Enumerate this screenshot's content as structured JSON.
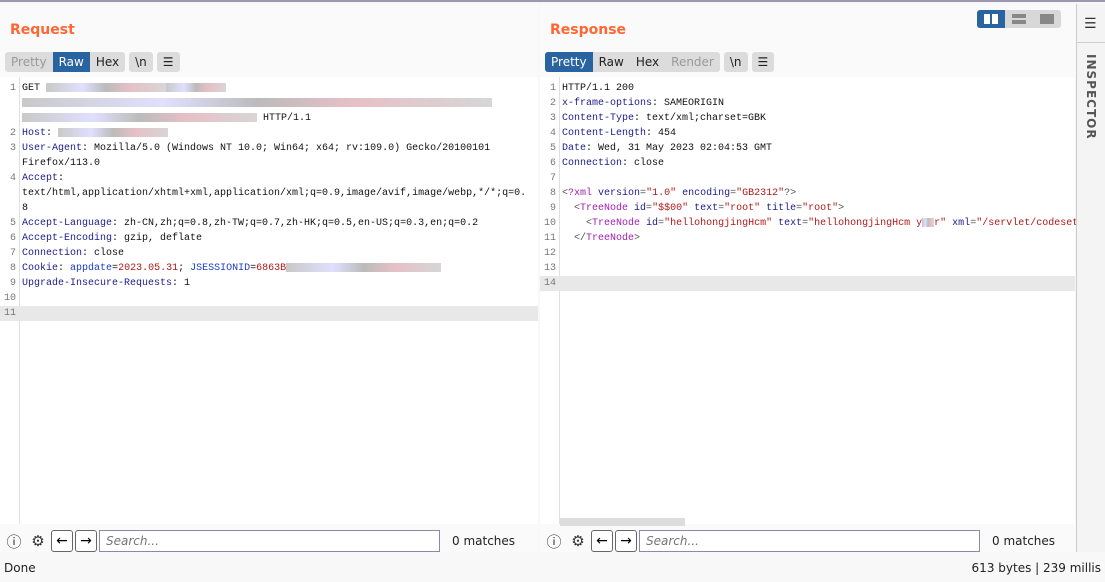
{
  "request": {
    "title": "Request",
    "tabs": [
      {
        "label": "Pretty",
        "state": "disabled"
      },
      {
        "label": "Raw",
        "state": "active"
      },
      {
        "label": "Hex",
        "state": "normal"
      }
    ],
    "newline_label": "\\n",
    "lines": [
      {
        "n": "1",
        "rows": [
          [
            [
              "v",
              "GET "
            ],
            [
              "red",
              120
            ],
            [
              "red",
              60
            ]
          ],
          [
            [
              "red",
              470
            ]
          ],
          [
            [
              "red",
              235
            ],
            [
              "v",
              " HTTP/1.1"
            ]
          ]
        ]
      },
      {
        "n": "2",
        "rows": [
          [
            [
              "k",
              "Host"
            ],
            [
              "v",
              ": "
            ],
            [
              "red",
              110
            ]
          ]
        ]
      },
      {
        "n": "3",
        "rows": [
          [
            [
              "k",
              "User-Agent"
            ],
            [
              "v",
              ": Mozilla/5.0 (Windows NT 10.0; Win64; x64; rv:109.0) Gecko/20100101"
            ]
          ],
          [
            [
              "v",
              "Firefox/113.0"
            ]
          ]
        ]
      },
      {
        "n": "4",
        "rows": [
          [
            [
              "k",
              "Accept"
            ],
            [
              "v",
              ":"
            ]
          ],
          [
            [
              "v",
              "text/html,application/xhtml+xml,application/xml;q=0.9,image/avif,image/webp,*/*;q=0."
            ]
          ],
          [
            [
              "v",
              "8"
            ]
          ]
        ]
      },
      {
        "n": "5",
        "rows": [
          [
            [
              "k",
              "Accept-Language"
            ],
            [
              "v",
              ": zh-CN,zh;q=0.8,zh-TW;q=0.7,zh-HK;q=0.5,en-US;q=0.3,en;q=0.2"
            ]
          ]
        ]
      },
      {
        "n": "6",
        "rows": [
          [
            [
              "k",
              "Accept-Encoding"
            ],
            [
              "v",
              ": gzip, deflate"
            ]
          ]
        ]
      },
      {
        "n": "7",
        "rows": [
          [
            [
              "k",
              "Connection"
            ],
            [
              "v",
              ": close"
            ]
          ]
        ]
      },
      {
        "n": "8",
        "rows": [
          [
            [
              "k",
              "Cookie"
            ],
            [
              "v",
              ": "
            ],
            [
              "ck",
              "appdate"
            ],
            [
              "v",
              "="
            ],
            [
              "cv",
              "2023.05.31"
            ],
            [
              "v",
              "; "
            ],
            [
              "ck",
              "JSESSIONID"
            ],
            [
              "v",
              "="
            ],
            [
              "cv",
              "6863B"
            ],
            [
              "red",
              155
            ]
          ]
        ]
      },
      {
        "n": "9",
        "rows": [
          [
            [
              "k",
              "Upgrade-Insecure-Requests"
            ],
            [
              "v",
              ": 1"
            ]
          ]
        ]
      },
      {
        "n": "10",
        "rows": [
          []
        ]
      },
      {
        "n": "11",
        "rows": [
          []
        ],
        "highlight": true
      }
    ],
    "search_placeholder": "Search...",
    "matches": "0 matches"
  },
  "response": {
    "title": "Response",
    "tabs": [
      {
        "label": "Pretty",
        "state": "active"
      },
      {
        "label": "Raw",
        "state": "normal"
      },
      {
        "label": "Hex",
        "state": "normal"
      },
      {
        "label": "Render",
        "state": "disabled"
      }
    ],
    "newline_label": "\\n",
    "lines": [
      {
        "n": "1",
        "rows": [
          [
            [
              "v",
              "HTTP/1.1 200"
            ]
          ]
        ]
      },
      {
        "n": "2",
        "rows": [
          [
            [
              "k",
              "x-frame-options"
            ],
            [
              "v",
              ": SAMEORIGIN"
            ]
          ]
        ]
      },
      {
        "n": "3",
        "rows": [
          [
            [
              "k",
              "Content-Type"
            ],
            [
              "v",
              ": text/xml;charset=GBK"
            ]
          ]
        ]
      },
      {
        "n": "4",
        "rows": [
          [
            [
              "k",
              "Content-Length"
            ],
            [
              "v",
              ": 454"
            ]
          ]
        ]
      },
      {
        "n": "5",
        "rows": [
          [
            [
              "k",
              "Date"
            ],
            [
              "v",
              ": Wed, 31 May 2023 02:04:53 GMT"
            ]
          ]
        ]
      },
      {
        "n": "6",
        "rows": [
          [
            [
              "k",
              "Connection"
            ],
            [
              "v",
              ": close"
            ]
          ]
        ]
      },
      {
        "n": "7",
        "rows": [
          []
        ]
      },
      {
        "n": "8",
        "rows": [
          [
            [
              "pu",
              "<"
            ],
            [
              "tag",
              "?xml"
            ],
            [
              "at",
              " version"
            ],
            [
              "pu",
              "="
            ],
            [
              "av",
              "\"1.0\""
            ],
            [
              "at",
              " encoding"
            ],
            [
              "pu",
              "="
            ],
            [
              "av",
              "\"GB2312\""
            ],
            [
              "pu",
              "?>"
            ]
          ]
        ]
      },
      {
        "n": "9",
        "rows": [
          [
            [
              "pu",
              "  <"
            ],
            [
              "tag",
              "TreeNode"
            ],
            [
              "at",
              " id"
            ],
            [
              "pu",
              "="
            ],
            [
              "av",
              "\"$$00\""
            ],
            [
              "at",
              " text"
            ],
            [
              "pu",
              "="
            ],
            [
              "av",
              "\"root\""
            ],
            [
              "at",
              " title"
            ],
            [
              "pu",
              "="
            ],
            [
              "av",
              "\"root\""
            ],
            [
              "pu",
              ">"
            ]
          ]
        ]
      },
      {
        "n": "10",
        "rows": [
          [
            [
              "pu",
              "    <"
            ],
            [
              "tag",
              "TreeNode"
            ],
            [
              "at",
              " id"
            ],
            [
              "pu",
              "="
            ],
            [
              "av",
              "\"hellohongjingHcm\""
            ],
            [
              "at",
              " text"
            ],
            [
              "pu",
              "="
            ],
            [
              "av",
              "\"hellohongjingHcm y"
            ],
            [
              "red",
              12
            ],
            [
              "av",
              "r\""
            ],
            [
              "at",
              " xml"
            ],
            [
              "pu",
              "="
            ],
            [
              "av",
              "\"/servlet/codesetTree?xxxxx"
            ]
          ]
        ]
      },
      {
        "n": "11",
        "rows": [
          [
            [
              "pu",
              "  </"
            ],
            [
              "tag",
              "TreeNode"
            ],
            [
              "pu",
              ">"
            ]
          ]
        ]
      },
      {
        "n": "12",
        "rows": [
          []
        ]
      },
      {
        "n": "13",
        "rows": [
          []
        ]
      },
      {
        "n": "14",
        "rows": [
          []
        ],
        "highlight": true
      }
    ],
    "search_placeholder": "Search...",
    "matches": "0 matches"
  },
  "sidebar": {
    "inspector_label": "INSPECTOR"
  },
  "status": {
    "left": "Done",
    "right": "613 bytes | 239 millis"
  },
  "colors": {
    "title": "#ff6633",
    "active_tab": "#2a64a0"
  }
}
